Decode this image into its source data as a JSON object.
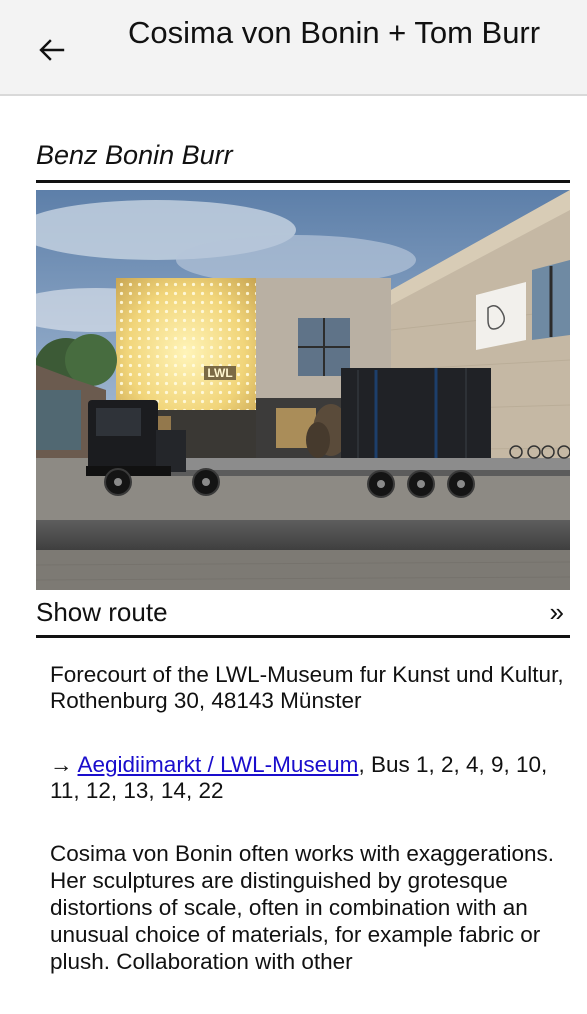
{
  "header": {
    "back_icon": "arrow-left-icon",
    "title": "Cosima von Bonin + Tom Burr"
  },
  "work": {
    "title": "Benz Bonin Burr",
    "photo_sign_text": "LWL"
  },
  "route": {
    "label": "Show route",
    "chevron": "»",
    "chevron_icon": "double-chevron-right-icon"
  },
  "location": {
    "address": "Forecourt of the LWL-Museum fur Kunst und Kultur, Rothenburg 30, 48143 Münster",
    "transit_arrow": "→",
    "stop_link": "Aegidiimarkt / LWL-Museum",
    "bus_lines": ", Bus 1, 2, 4, 9, 10, 11, 12, 13, 14, 22"
  },
  "description": "Cosima von Bonin often works with exaggerations. Her sculptures are distinguished by grotesque distortions of scale, often in combination with an unusual choice of materials, for example fabric or plush. Collaboration with other",
  "colors": {
    "appbar_bg": "#f3f3f3",
    "link": "#1a0dcc",
    "text": "#111111"
  }
}
